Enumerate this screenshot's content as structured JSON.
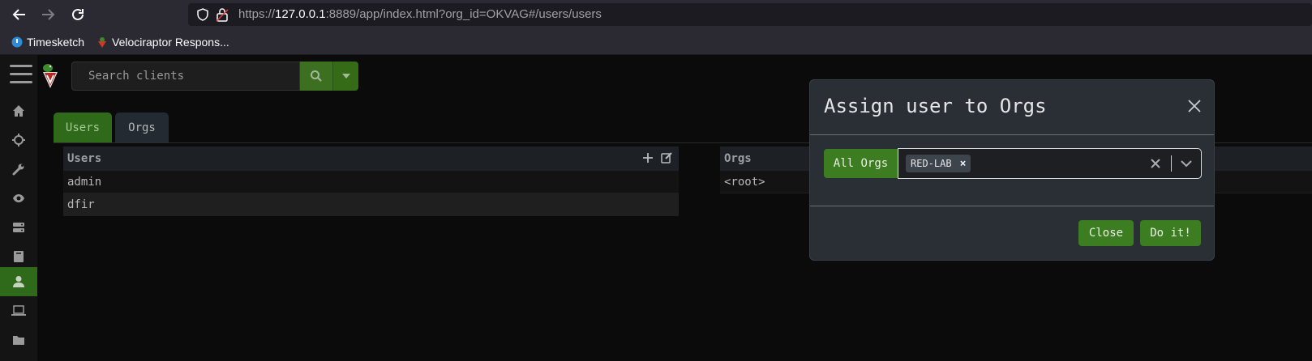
{
  "browser": {
    "url_prefix": "https://",
    "url_host": "127.0.0.1",
    "url_rest": ":8889/app/index.html?org_id=OKVAG#/users/users",
    "bookmarks": [
      {
        "label": "Timesketch"
      },
      {
        "label": "Velociraptor Respons..."
      }
    ]
  },
  "app": {
    "search": {
      "placeholder": "Search clients"
    },
    "tabs": [
      {
        "label": "Users",
        "active": true
      },
      {
        "label": "Orgs",
        "active": false
      }
    ],
    "users_panel": {
      "header": "Users",
      "rows": [
        {
          "name": "admin"
        },
        {
          "name": "dfir"
        }
      ]
    },
    "orgs_panel": {
      "header": "Orgs",
      "rows": [
        {
          "name": "<root>"
        }
      ]
    },
    "sidebar": {
      "items": [
        "home-icon",
        "crosshair-icon",
        "wrench-icon",
        "eye-icon",
        "server-icon",
        "book-icon",
        "user-icon",
        "laptop-icon",
        "folder-icon"
      ],
      "active": "user-icon"
    }
  },
  "modal": {
    "title": "Assign user to Orgs",
    "all_orgs_label": "All Orgs",
    "selected_orgs": [
      {
        "label": "RED-LAB"
      }
    ],
    "close_label": "Close",
    "submit_label": "Do it!"
  },
  "colors": {
    "accent_green": "#3c7d22",
    "sidebar_active": "#2f6a1a",
    "modal_bg": "#2a2f36"
  }
}
